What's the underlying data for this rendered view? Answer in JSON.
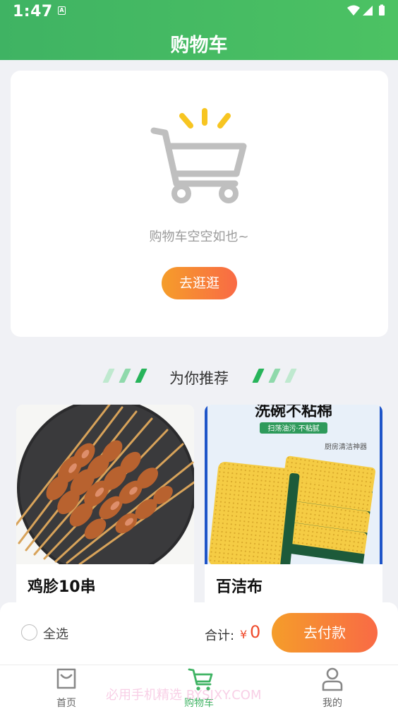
{
  "status_bar": {
    "time": "1:47",
    "badge": "A"
  },
  "header": {
    "title": "购物车"
  },
  "empty_cart": {
    "message": "购物车空空如也~",
    "button_label": "去逛逛"
  },
  "recommend": {
    "title": "为你推荐"
  },
  "products": [
    {
      "name": "鸡胗10串"
    },
    {
      "name": "百洁布",
      "image_text": "洗碗不粘棉",
      "image_badge": "扫荡油污·不粘腻",
      "image_caption": "厨房清洁神器"
    }
  ],
  "checkout": {
    "select_all": "全选",
    "total_label": "合计:",
    "currency": "¥",
    "total_value": "0",
    "pay_button": "去付款"
  },
  "tabs": [
    {
      "label": "首页"
    },
    {
      "label": "购物车"
    },
    {
      "label": "我的"
    }
  ],
  "watermark": "必用手机精选 BYSJXY.COM",
  "colors": {
    "brand_green": "#3fb363",
    "accent_orange": "#f59d2a",
    "accent_red": "#f96a45",
    "price_red": "#f04b2c"
  }
}
